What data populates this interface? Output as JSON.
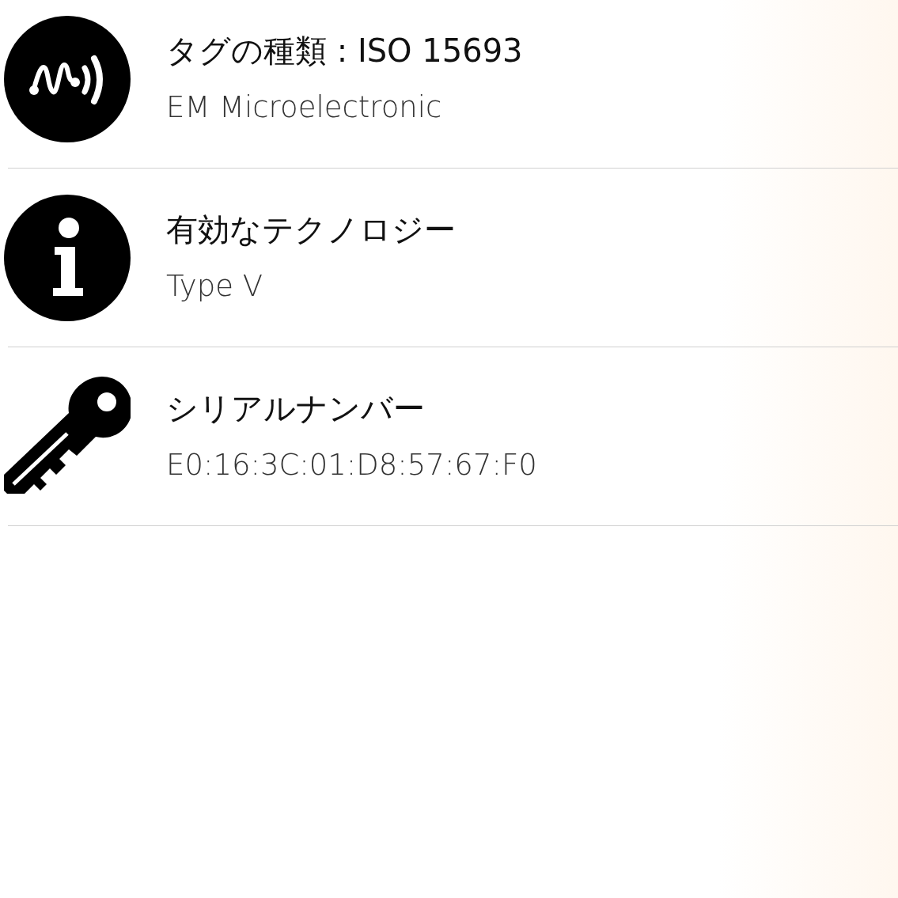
{
  "rows": [
    {
      "kind": "nfc",
      "title": "タグの種類 : ISO 15693",
      "value": "EM Microelectronic"
    },
    {
      "kind": "info",
      "title": "有効なテクノロジー",
      "value": "Type V"
    },
    {
      "kind": "key",
      "title": "シリアルナンバー",
      "value": "E0:16:3C:01:D8:57:67:F0"
    }
  ]
}
